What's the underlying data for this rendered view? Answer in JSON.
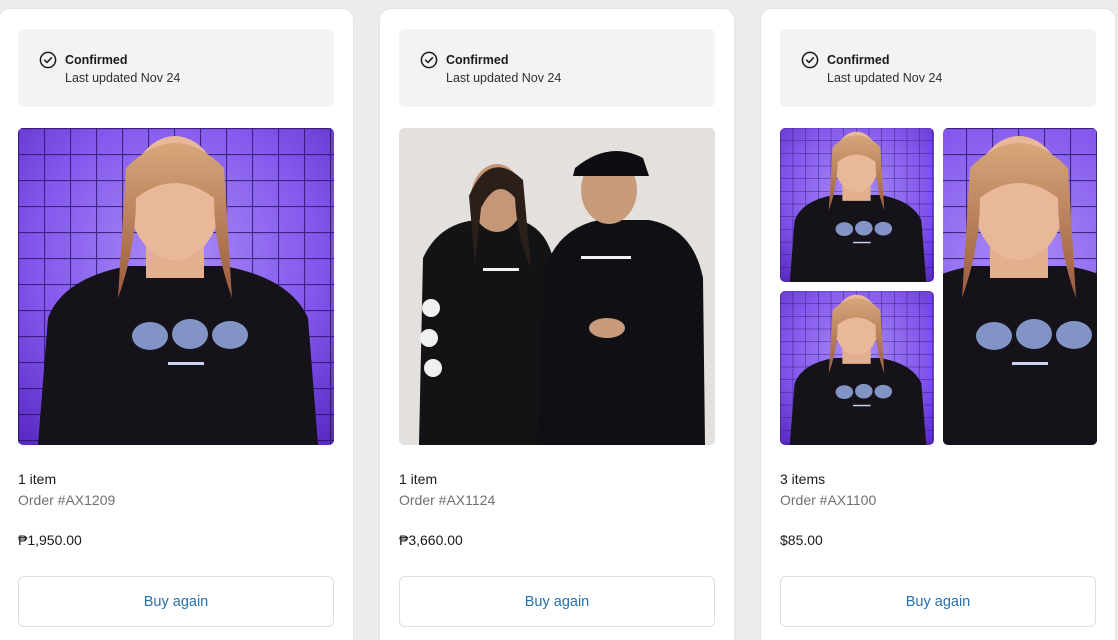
{
  "colors": {
    "card_background": "#ffffff",
    "status_background": "#f3f3f3",
    "link_blue": "#2a6fa8",
    "page_background": "#ececec"
  },
  "orders": [
    {
      "status": {
        "icon": "check-circle-icon",
        "title": "Confirmed",
        "updated": "Last updated Nov 24"
      },
      "images": [
        "man-black-tshirt-purple-grid-photo"
      ],
      "item_count": "1 item",
      "order_number": "Order #AX1209",
      "price": "₱1,950.00",
      "action_label": "Buy again"
    },
    {
      "status": {
        "icon": "check-circle-icon",
        "title": "Confirmed",
        "updated": "Last updated Nov 24"
      },
      "images": [
        "couple-black-hoodies-photo"
      ],
      "item_count": "1 item",
      "order_number": "Order #AX1124",
      "price": "₱3,660.00",
      "action_label": "Buy again"
    },
    {
      "status": {
        "icon": "check-circle-icon",
        "title": "Confirmed",
        "updated": "Last updated Nov 24"
      },
      "images": [
        "man-black-tshirt-photo",
        "man-black-tshirt-photo",
        "man-black-tshirt-photo"
      ],
      "item_count": "3 items",
      "order_number": "Order #AX1100",
      "price": "$85.00",
      "action_label": "Buy again"
    }
  ]
}
